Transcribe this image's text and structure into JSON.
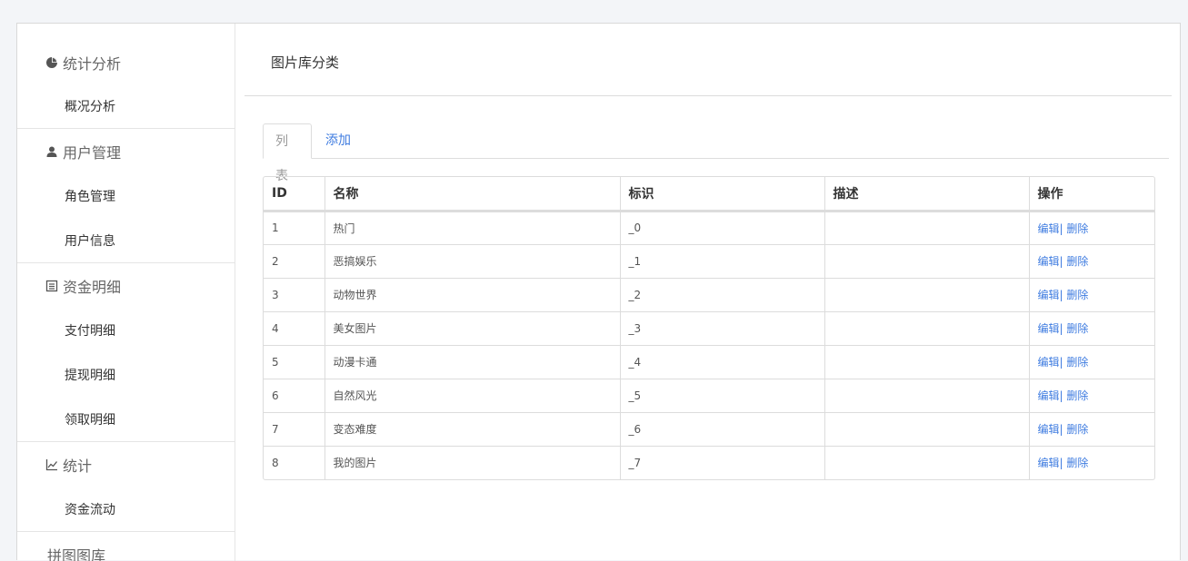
{
  "sidebar": {
    "groups": [
      {
        "label": "统计分析",
        "icon": "pie-chart-icon",
        "items": [
          "概况分析"
        ]
      },
      {
        "label": "用户管理",
        "icon": "user-icon",
        "items": [
          "角色管理",
          "用户信息"
        ]
      },
      {
        "label": "资金明细",
        "icon": "list-icon",
        "items": [
          "支付明细",
          "提现明细",
          "领取明细"
        ]
      },
      {
        "label": "统计",
        "icon": "line-chart-icon",
        "items": [
          "资金流动"
        ]
      },
      {
        "label": "拼图图库",
        "icon": "",
        "items": []
      }
    ]
  },
  "main": {
    "title": "图片库分类",
    "tabs": {
      "list": "列表",
      "add": "添加"
    },
    "table": {
      "headers": [
        "ID",
        "名称",
        "标识",
        "描述",
        "操作"
      ],
      "rows": [
        {
          "id": "1",
          "name": "热门",
          "tag": "_0",
          "desc": ""
        },
        {
          "id": "2",
          "name": "恶搞娱乐",
          "tag": "_1",
          "desc": ""
        },
        {
          "id": "3",
          "name": "动物世界",
          "tag": "_2",
          "desc": ""
        },
        {
          "id": "4",
          "name": "美女图片",
          "tag": "_3",
          "desc": ""
        },
        {
          "id": "5",
          "name": "动漫卡通",
          "tag": "_4",
          "desc": ""
        },
        {
          "id": "6",
          "name": "自然风光",
          "tag": "_5",
          "desc": ""
        },
        {
          "id": "7",
          "name": "变态难度",
          "tag": "_6",
          "desc": ""
        },
        {
          "id": "8",
          "name": "我的图片",
          "tag": "_7",
          "desc": ""
        }
      ],
      "edit_label": "编辑",
      "separator": "|",
      "delete_label": "删除"
    }
  },
  "colors": {
    "link": "#3f7ce0",
    "border": "#dcdcdc",
    "background": "#f3f5f8"
  }
}
